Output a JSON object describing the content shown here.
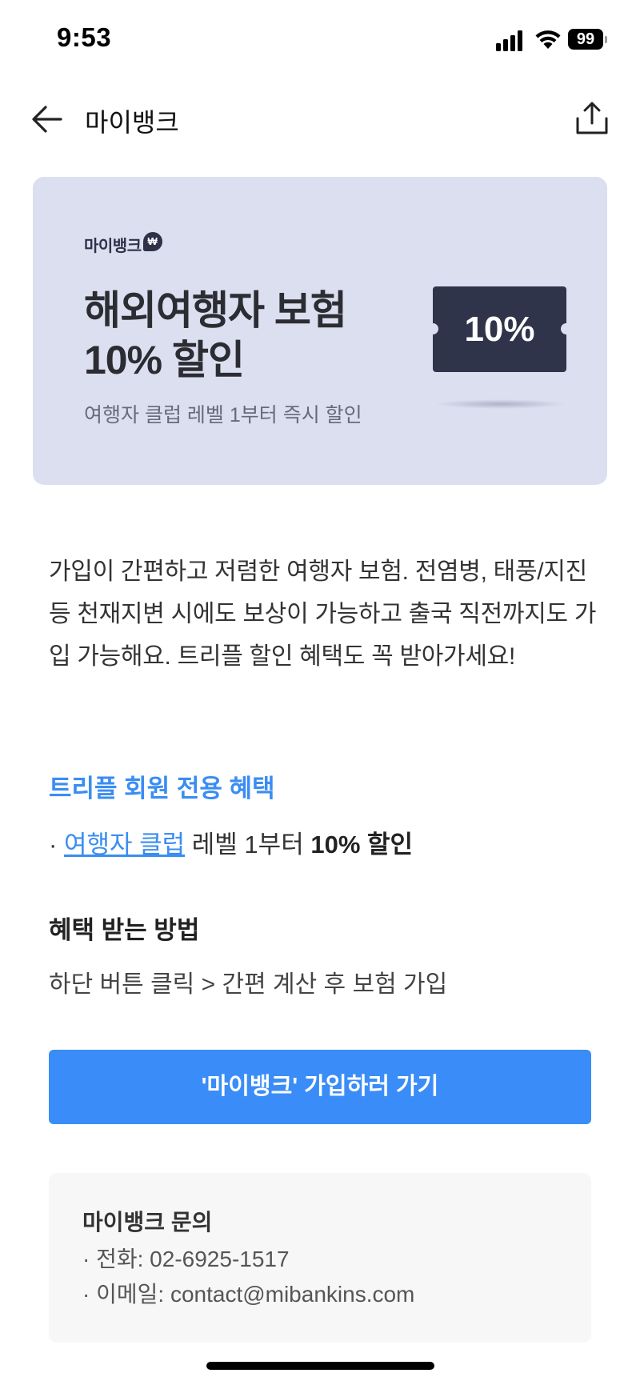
{
  "status_bar": {
    "time": "9:53",
    "battery": "99",
    "icons": [
      "signal-icon",
      "wifi-icon",
      "battery-icon"
    ]
  },
  "nav": {
    "title": "마이뱅크",
    "back_icon": "arrow-left-icon",
    "share_icon": "share-icon"
  },
  "banner": {
    "brand": "마이뱅크",
    "brand_badge": "₩",
    "title_line1": "해외여행자 보험",
    "title_line2": "10% 할인",
    "subtitle": "여행자 클럽 레벨 1부터 즉시 할인",
    "coupon_text": "10%",
    "background_color": "#dcdff0",
    "coupon_color": "#30344a"
  },
  "description": "가입이 간편하고 저렴한 여행자 보험. 전염병, 태풍/지진 등 천재지변 시에도 보상이 가능하고 출국 직전까지도 가입 가능해요. 트리플 할인 혜택도 꼭 받아가세요!",
  "benefit": {
    "heading": "트리플 회원 전용 혜택",
    "bullet": "·",
    "link_text": "여행자 클럽",
    "middle_text": " 레벨 1부터 ",
    "strong_text": "10% 할인",
    "accent_color": "#3a8df2"
  },
  "method": {
    "heading": "혜택 받는 방법",
    "text": "하단 버튼 클릭 > 간편 계산 후 보험 가입"
  },
  "cta": {
    "label": "'마이뱅크' 가입하러 가기",
    "color": "#3a8df8"
  },
  "contact": {
    "title": "마이뱅크 문의",
    "phone": "· 전화: 02-6925-1517",
    "email": "· 이메일: contact@mibankins.com"
  }
}
